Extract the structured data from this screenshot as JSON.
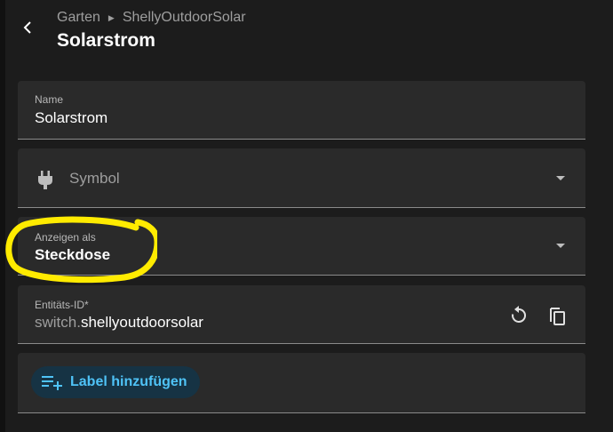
{
  "header": {
    "breadcrumb": [
      "Garten",
      "ShellyOutdoorSolar"
    ],
    "title": "Solarstrom"
  },
  "fields": {
    "name": {
      "label": "Name",
      "value": "Solarstrom"
    },
    "icon": {
      "placeholder": "Symbol"
    },
    "show_as": {
      "label": "Anzeigen als",
      "value": "Steckdose"
    },
    "entity_id": {
      "label": "Entitäts-ID*",
      "prefix": "switch.",
      "value": "shellyoutdoorsolar"
    }
  },
  "labels": {
    "add_label": "Label hinzufügen"
  },
  "colors": {
    "accent": "#4fc3f7",
    "annotation": "#ffeb00",
    "surface": "#2a2a2a",
    "background": "#1c1c1c"
  },
  "icons": [
    "back-arrow-icon",
    "plug-icon",
    "dropdown-arrow-icon",
    "reset-icon",
    "copy-icon",
    "label-add-icon"
  ]
}
